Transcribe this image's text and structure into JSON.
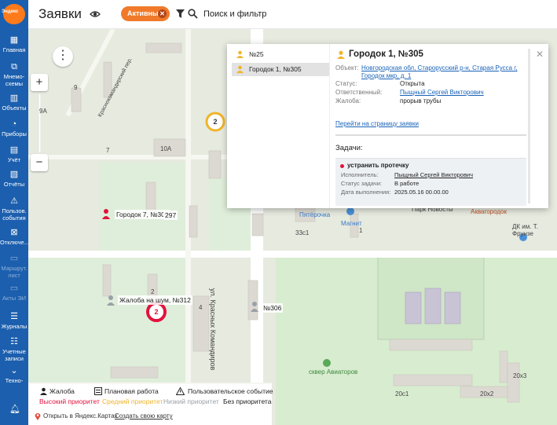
{
  "brand": {
    "logo_text": "Эндекс"
  },
  "sidebar": {
    "items": [
      {
        "label": "Главная",
        "icon": "grid-icon"
      },
      {
        "label": "Мнемо-схемы",
        "icon": "scheme-icon"
      },
      {
        "label": "Объекты",
        "icon": "buildings-icon"
      },
      {
        "label": "Приборы",
        "icon": "gauge-icon"
      },
      {
        "label": "Учёт",
        "icon": "calculator-icon"
      },
      {
        "label": "Отчёты",
        "icon": "report-icon"
      },
      {
        "label": "Пользов. события",
        "icon": "warning-icon"
      },
      {
        "label": "Отключе...",
        "icon": "off-icon"
      },
      {
        "label": "Маршрут. лист",
        "icon": "route-icon"
      },
      {
        "label": "Акты ЭИ",
        "icon": "acts-icon"
      },
      {
        "label": "Журналы",
        "icon": "journal-icon"
      },
      {
        "label": "Учетные записи",
        "icon": "users-icon"
      },
      {
        "label": "Техно-",
        "icon": "chevron-down-icon"
      }
    ],
    "bell_icon": "bell-icon"
  },
  "header": {
    "title": "Заявки",
    "active_chip": "Активные",
    "search_placeholder": "Поиск и фильтр"
  },
  "map": {
    "labels": {
      "gorodok7": "Городок 7, №309",
      "n297": "297",
      "complaint": "Жалоба на шум, №312",
      "n306": "№306",
      "pyaterochka": "Пятёрочка",
      "magnit": "Магнит",
      "park": "Парк Новосты",
      "akvagorodok": "Аквагородок",
      "dk": "ДК им. Т. Фрунзе",
      "skver": "сквер Авиаторов",
      "street": "ул. Красных Командиров",
      "street2": "Краснокомандирский пер.",
      "house_10a": "10А",
      "house_33": "33с1",
      "house_20": "20х3",
      "house_20b": "20х2",
      "house_20c": "20с1",
      "house_1": "1",
      "house_2": "2",
      "house_4": "4",
      "house_7": "7",
      "house_9a": "9А",
      "house_9": "9"
    },
    "clusters": [
      {
        "count": "2",
        "color": "#f0b429"
      },
      {
        "count": "2",
        "color": "#e3123c"
      }
    ],
    "zoom_in": "+",
    "zoom_out": "−",
    "menu": "⋮"
  },
  "popup": {
    "list": [
      {
        "label": "№25",
        "selected": false
      },
      {
        "label": "Городок 1, №305",
        "selected": true
      }
    ],
    "title": "Городок 1, №305",
    "fields": {
      "object_label": "Объект:",
      "object_value": "Новгородская обл, Старорусский р-н, Старая Русса г, Городок мкр, д. 1",
      "status_label": "Статус:",
      "status_value": "Открыта",
      "resp_label": "Ответственный:",
      "resp_value": "Пыщный Сергей Викторович",
      "complaint_label": "Жалоба:",
      "complaint_value": "прорыв трубы"
    },
    "goto_link": "Перейти на страницу заявки",
    "tasks_header": "Задачи:",
    "task": {
      "title": "устранить протечку",
      "executor_label": "Исполнитель:",
      "executor_value": "Пыщный Сергей Викторович",
      "status_label": "Статус задачи:",
      "status_value": "В работе",
      "date_label": "Дата выполнения:",
      "date_value": "2025.05.16 00.00.00"
    }
  },
  "legend": {
    "complaint": "Жалоба",
    "planned": "Плановая работа",
    "user_event": "Пользовательское событие",
    "high": "Высокий приоритет",
    "medium": "Средний приоритет",
    "low": "Низкий приоритет",
    "none": "Без приоритета",
    "open_yandex": "Открыть в Яндекс.Картах",
    "create_map": "Создать свою карту",
    "colors": {
      "high": "#e3123c",
      "medium": "#f0b429",
      "low": "#9aa0a6",
      "none": "#222222"
    }
  }
}
